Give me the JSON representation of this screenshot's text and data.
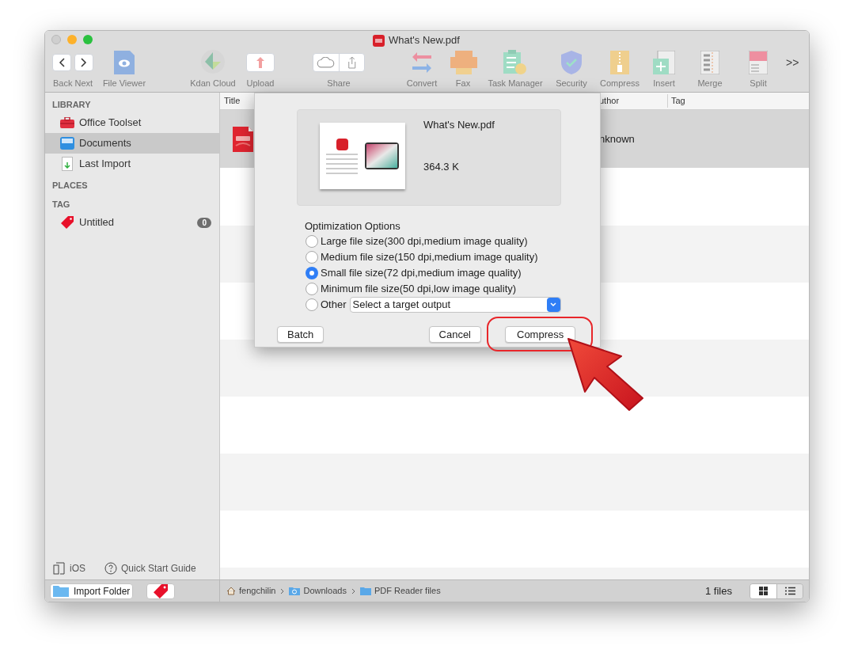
{
  "window": {
    "title": "What's New.pdf"
  },
  "toolbar": {
    "items": [
      {
        "kind": "nav",
        "label": "Back Next"
      },
      {
        "kind": "viewer",
        "label": "File Viewer"
      },
      {
        "kind": "cloud",
        "label": "Kdan Cloud"
      },
      {
        "kind": "upload",
        "label": "Upload"
      },
      {
        "kind": "share",
        "label": "Share"
      },
      {
        "kind": "convert",
        "label": "Convert"
      },
      {
        "kind": "fax",
        "label": "Fax"
      },
      {
        "kind": "tasks",
        "label": "Task Manager"
      },
      {
        "kind": "security",
        "label": "Security"
      },
      {
        "kind": "compress",
        "label": "Compress"
      },
      {
        "kind": "insert",
        "label": "Insert"
      },
      {
        "kind": "merge",
        "label": "Merge"
      },
      {
        "kind": "split",
        "label": "Split"
      }
    ],
    "overflow": ">>"
  },
  "sidebar": {
    "sections": [
      {
        "title": "LIBRARY",
        "items": [
          {
            "kind": "toolset",
            "label": "Office Toolset",
            "selected": false
          },
          {
            "kind": "documents",
            "label": "Documents",
            "selected": true
          },
          {
            "kind": "import",
            "label": "Last Import",
            "selected": false
          }
        ]
      },
      {
        "title": "PLACES"
      },
      {
        "title": "TAG",
        "items": [
          {
            "kind": "tag",
            "label": "Untitled",
            "selected": false,
            "count": "0"
          }
        ]
      }
    ],
    "footer": [
      {
        "kind": "ios",
        "label": "iOS"
      },
      {
        "kind": "help",
        "label": "Quick Start Guide"
      }
    ],
    "import_button": "Import Folder"
  },
  "table": {
    "columns": [
      "Title",
      "uthor",
      "Tag"
    ],
    "rows": [
      {
        "selected": true,
        "author": "nknown"
      }
    ]
  },
  "dialog": {
    "file_name": "What's New.pdf",
    "file_size": "364.3 K",
    "options_title": "Optimization Options",
    "options": [
      {
        "kind": "plain",
        "label": "Large file size(300 dpi,medium image quality)",
        "selected": false
      },
      {
        "kind": "plain",
        "label": "Medium file size(150 dpi,medium image quality)",
        "selected": false
      },
      {
        "kind": "plain",
        "label": "Small file size(72 dpi,medium image quality)",
        "selected": true
      },
      {
        "kind": "plain",
        "label": "Minimum file size(50 dpi,low image quality)",
        "selected": false
      },
      {
        "kind": "other",
        "label": "Other",
        "selected": false,
        "value": "Select a target output"
      }
    ],
    "buttons": [
      {
        "kind": "left",
        "label": "Batch",
        "highlighted": false
      },
      {
        "kind": "right",
        "label": "Cancel",
        "highlighted": false
      },
      {
        "kind": "right",
        "label": "Compress",
        "highlighted": true
      }
    ]
  },
  "status_bar": {
    "path": [
      {
        "kind": "home",
        "label": "fengchilin"
      },
      {
        "kind": "downloads",
        "label": "Downloads"
      },
      {
        "kind": "folder",
        "label": "PDF Reader files"
      }
    ],
    "count": "1 files",
    "views": [
      {
        "kind": "grid",
        "selected": true
      },
      {
        "kind": "list",
        "selected": false
      }
    ]
  }
}
